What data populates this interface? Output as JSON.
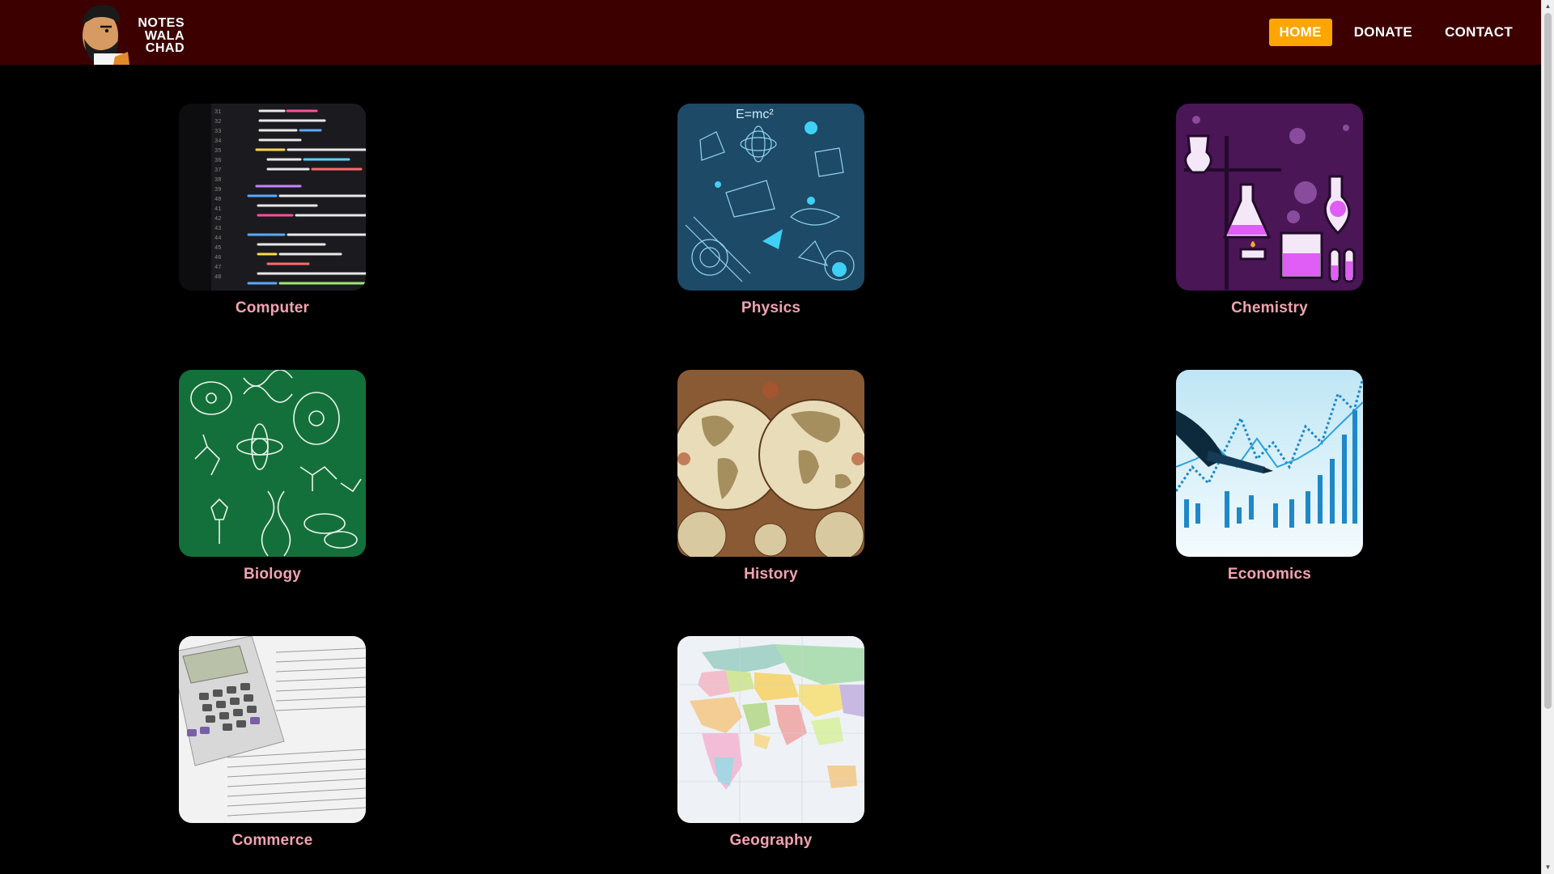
{
  "brand": {
    "line1": "NOTES",
    "line2": "WALA",
    "line3": "CHAD"
  },
  "nav": {
    "items": [
      {
        "label": "HOME",
        "active": true
      },
      {
        "label": "DONATE",
        "active": false
      },
      {
        "label": "CONTACT",
        "active": false
      }
    ]
  },
  "subjects": [
    {
      "label": "Computer",
      "image": "code-screen-image"
    },
    {
      "label": "Physics",
      "image": "physics-diagram-image"
    },
    {
      "label": "Chemistry",
      "image": "lab-flasks-image"
    },
    {
      "label": "Biology",
      "image": "biology-chalkboard-image"
    },
    {
      "label": "History",
      "image": "antique-world-map-image"
    },
    {
      "label": "Economics",
      "image": "stock-chart-image"
    },
    {
      "label": "Commerce",
      "image": "calculator-documents-image"
    },
    {
      "label": "Geography",
      "image": "political-world-map-image"
    }
  ],
  "colors": {
    "navbar": "#3d0000",
    "accent": "#ffa500",
    "label": "#f0a3b0",
    "background": "#000000"
  }
}
